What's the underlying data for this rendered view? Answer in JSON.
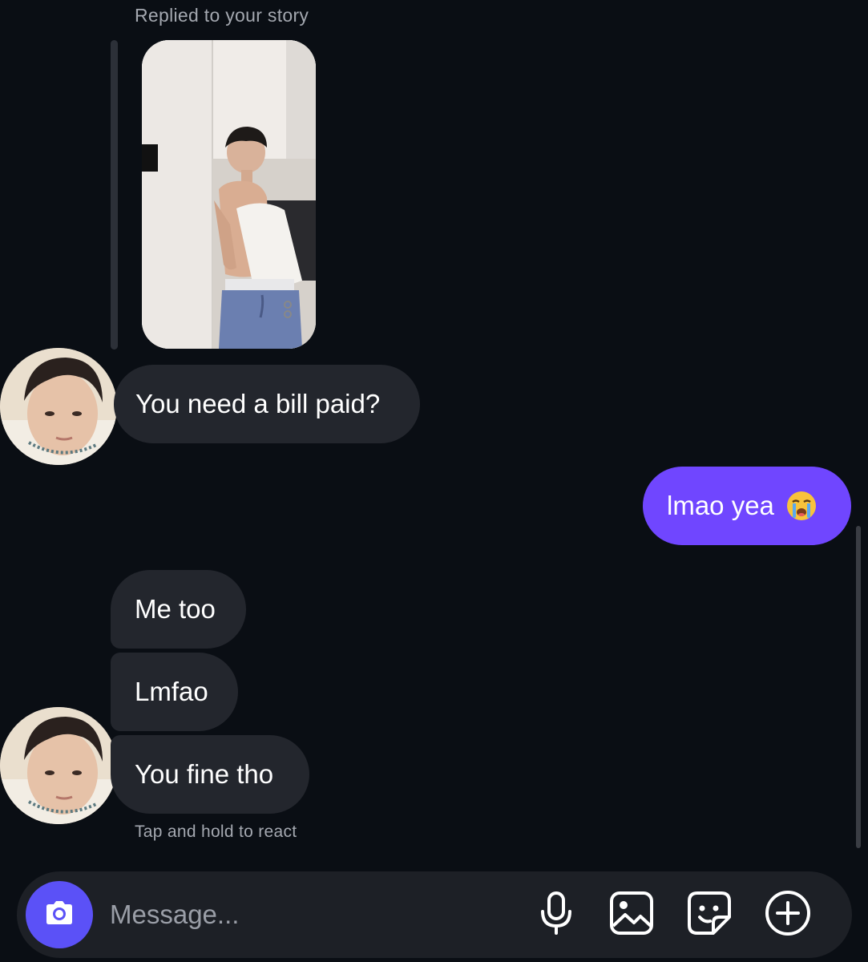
{
  "thread": {
    "reply_label": "Replied to your story",
    "messages": [
      {
        "direction": "incoming",
        "text": "You need a bill paid?"
      },
      {
        "direction": "outgoing",
        "text": "lmao yea",
        "emoji": "loudly-crying-face"
      },
      {
        "direction": "incoming",
        "text": "Me too"
      },
      {
        "direction": "incoming",
        "text": "Lmfao"
      },
      {
        "direction": "incoming",
        "text": "You fine tho"
      }
    ],
    "react_hint": "Tap and hold to react"
  },
  "composer": {
    "placeholder": "Message...",
    "icons": [
      "camera-icon",
      "microphone-icon",
      "gallery-icon",
      "sticker-icon",
      "add-icon"
    ]
  },
  "colors": {
    "background": "#0a0e14",
    "incoming_bubble": "#23262d",
    "outgoing_bubble": "#7046ff",
    "camera_button": "#5b51f7",
    "composer": "#1d2026"
  }
}
